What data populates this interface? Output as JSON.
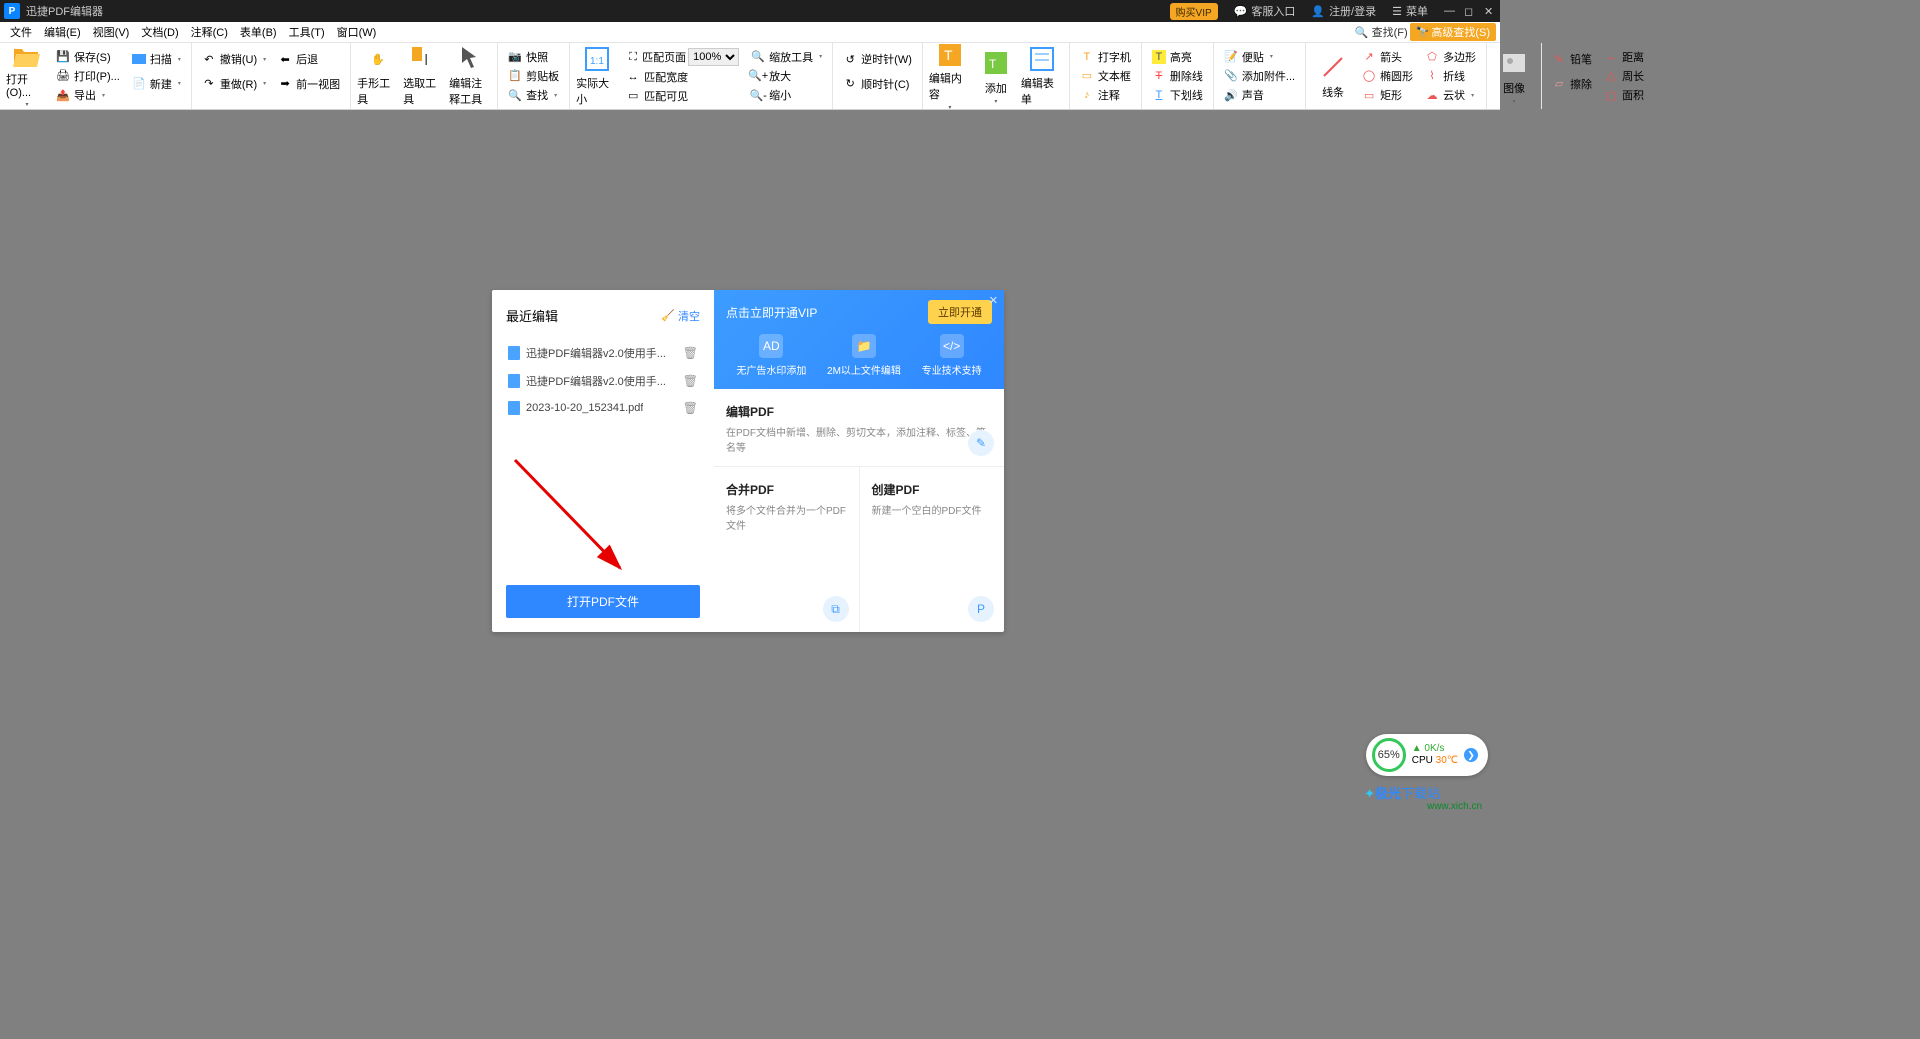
{
  "title_bar": {
    "app_name": "迅捷PDF编辑器",
    "vip_button": "购买VIP",
    "support": "客服入口",
    "login": "注册/登录",
    "menu": "菜单"
  },
  "menu": {
    "items": [
      "文件",
      "编辑(E)",
      "视图(V)",
      "文档(D)",
      "注释(C)",
      "表单(B)",
      "工具(T)",
      "窗口(W)"
    ],
    "find": "查找(F)",
    "advanced_find": "高级查找(S)"
  },
  "ribbon": {
    "open": "打开(O)...",
    "save": "保存(S)",
    "print": "打印(P)...",
    "export": "导出",
    "scan": "扫描",
    "new": "新建",
    "undo": "撤销(U)",
    "redo": "重做(R)",
    "back": "后退",
    "forward": "前一视图",
    "hand": "手形工具",
    "select": "选取工具",
    "edit_annot": "编辑注释工具",
    "snapshot": "快照",
    "clipboard": "剪贴板",
    "find_btn": "查找",
    "actual_size": "实际大小",
    "fit_page": "匹配页面",
    "fit_width": "匹配宽度",
    "fit_visible": "匹配可见",
    "zoom_value": "100%",
    "zoom_tool": "缩放工具",
    "zoom_in": "放大",
    "zoom_out": "缩小",
    "clockwise": "逆时针(W)",
    "counter_clockwise": "顺时针(C)",
    "edit_content": "编辑内容",
    "add": "添加",
    "edit_form": "编辑表单",
    "typewriter": "打字机",
    "textbox": "文本框",
    "annotate": "注释",
    "highlight": "高亮",
    "strikethrough": "删除线",
    "underline": "下划线",
    "note": "便贴",
    "attach": "添加附件...",
    "sound": "声音",
    "line": "线条",
    "rect": "矩形",
    "arrow_tool": "箭头",
    "ellipse": "椭圆形",
    "polygon": "多边形",
    "polyline": "折线",
    "cloud": "云状",
    "image": "图像",
    "pencil": "铅笔",
    "eraser": "擦除",
    "distance": "距离",
    "perimeter": "周长",
    "area": "面积"
  },
  "start_panel": {
    "recent_heading": "最近编辑",
    "clear": "清空",
    "files": [
      "迅捷PDF编辑器v2.0使用手...",
      "迅捷PDF编辑器v2.0使用手...",
      "2023-10-20_152341.pdf"
    ],
    "open_button": "打开PDF文件",
    "vip_banner": {
      "title": "点击立即开通VIP",
      "cta": "立即开通",
      "features": [
        "无广告水印添加",
        "2M以上文件编辑",
        "专业技术支持"
      ]
    },
    "edit_card": {
      "title": "编辑PDF",
      "desc": "在PDF文档中新增、删除、剪切文本，添加注释、标签、签名等"
    },
    "merge_card": {
      "title": "合并PDF",
      "desc": "将多个文件合并为一个PDF文件"
    },
    "create_card": {
      "title": "创建PDF",
      "desc": "新建一个空白的PDF文件"
    }
  },
  "cpu_widget": {
    "percent": "65%",
    "speed": "0K/s",
    "cpu_label": "CPU",
    "temp": "30℃"
  },
  "watermarks": {
    "site1_prefix": "极光",
    "site1_suffix": "下载站",
    "site2": "www.xich.cn"
  }
}
